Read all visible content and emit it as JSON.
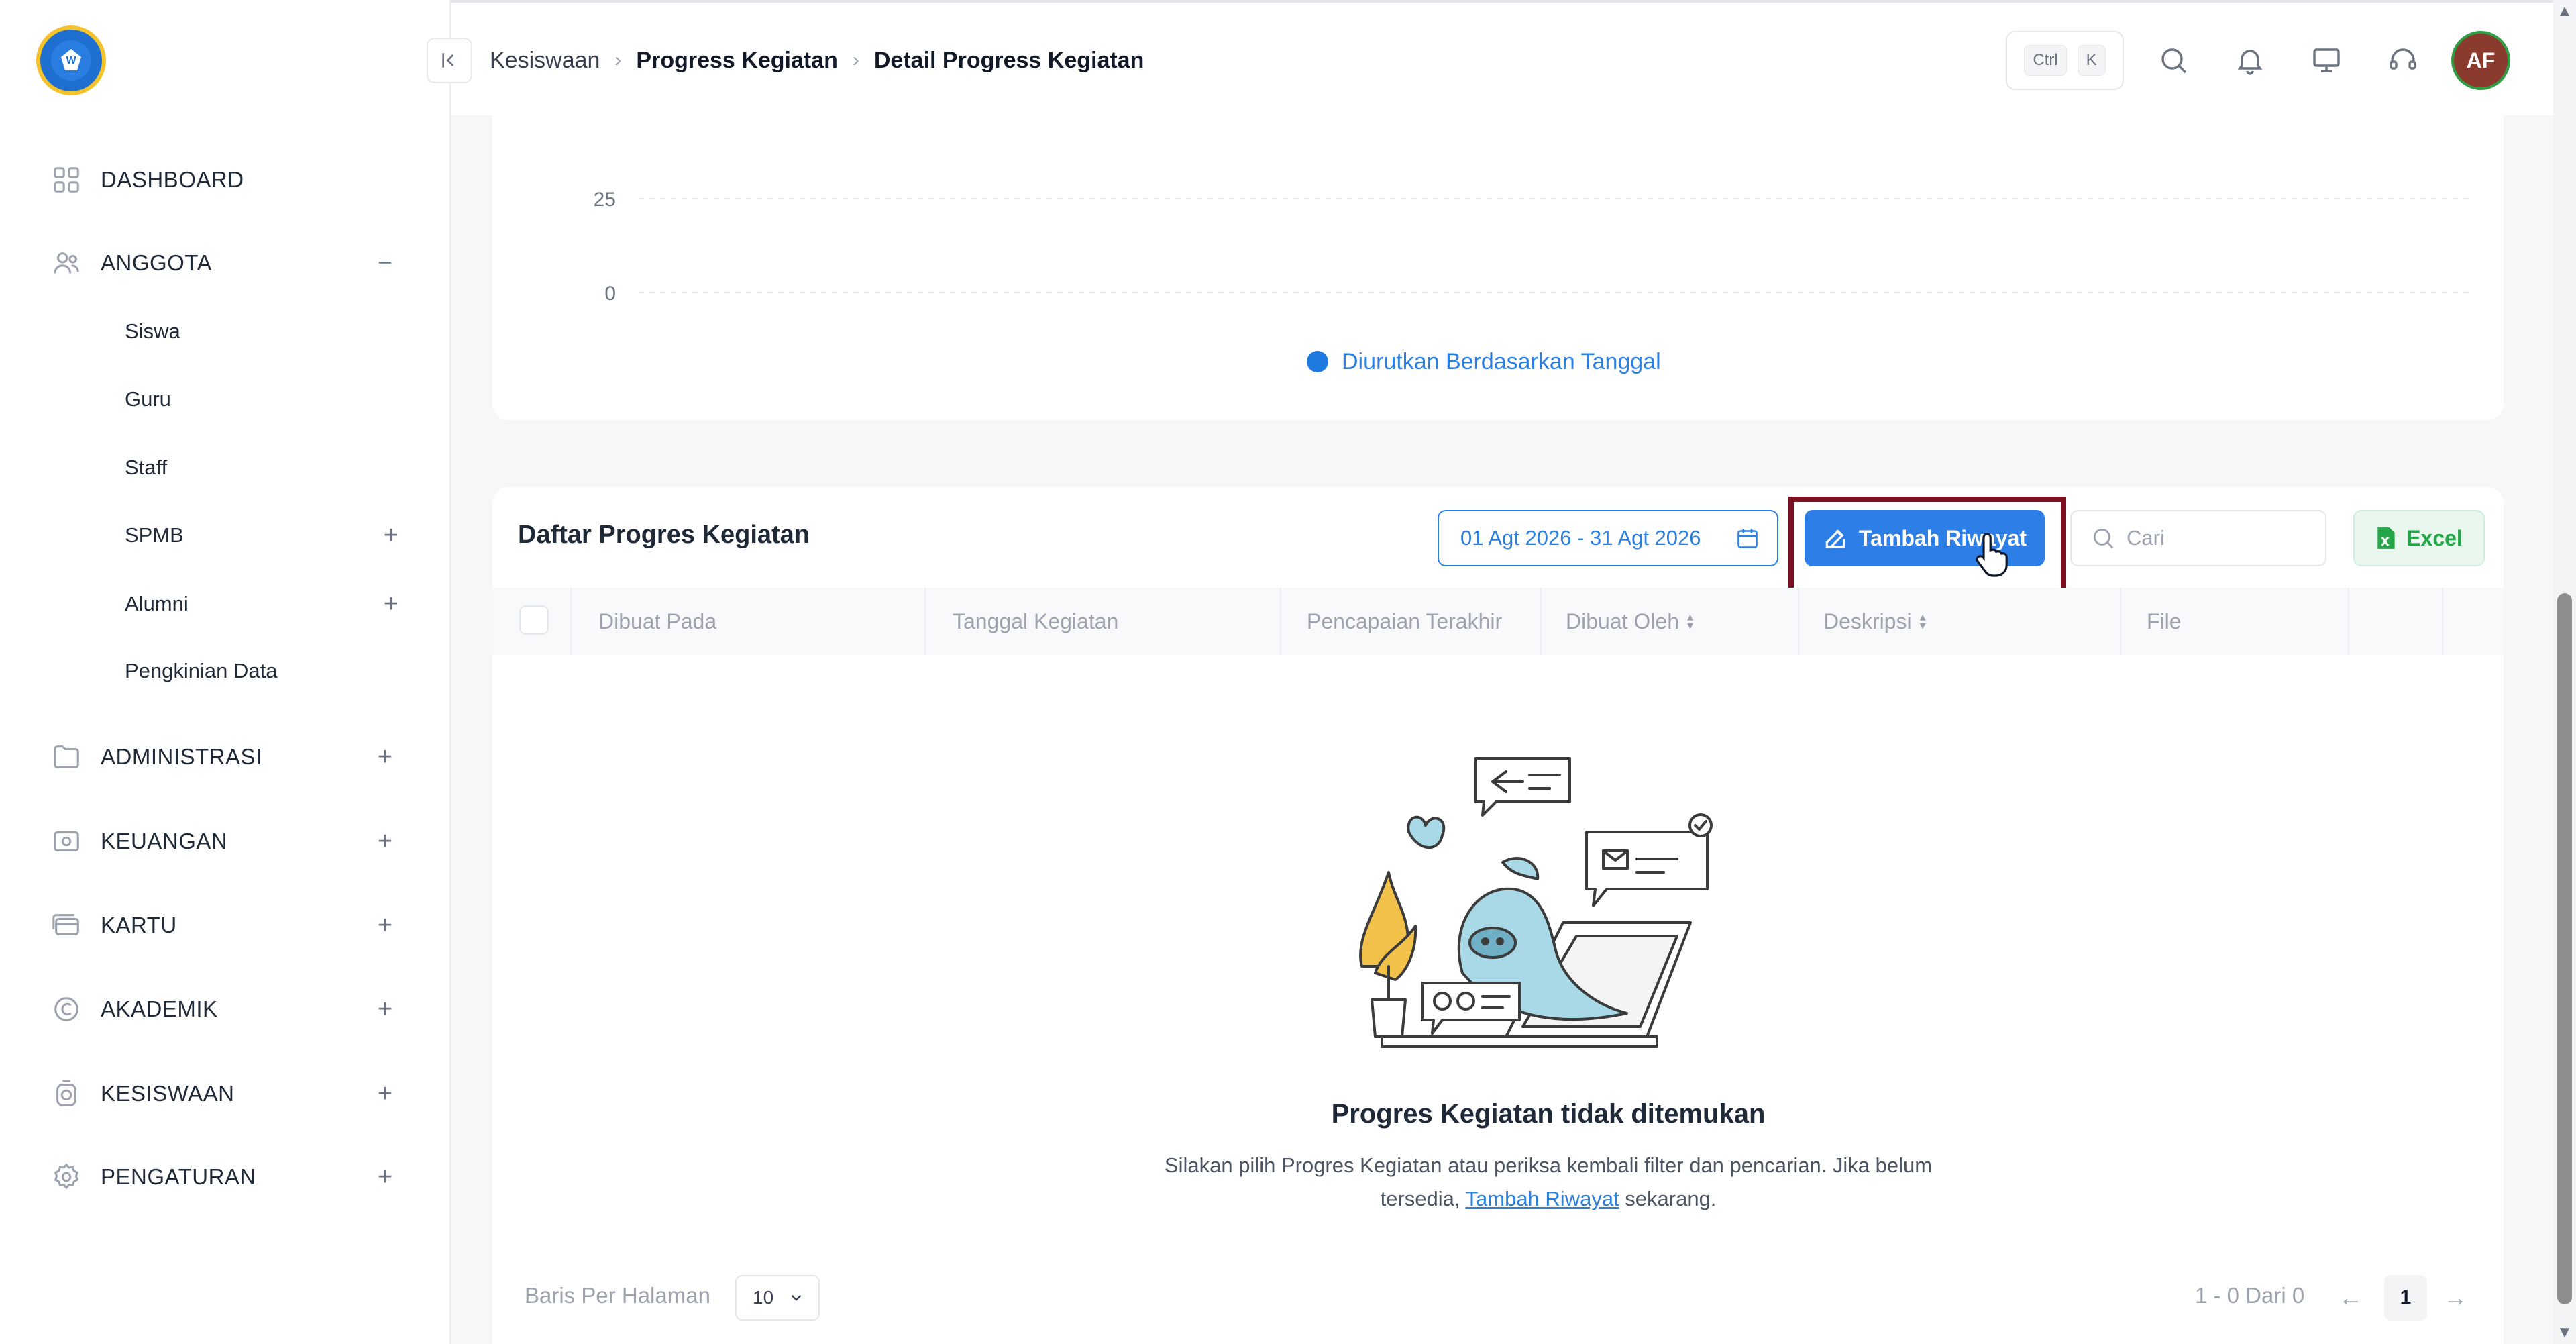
{
  "sidebar": {
    "items": [
      {
        "label": "DASHBOARD"
      },
      {
        "label": "ANGGOTA",
        "toggle": "−"
      },
      {
        "label": "ADMINISTRASI",
        "toggle": "+"
      },
      {
        "label": "KEUANGAN",
        "toggle": "+"
      },
      {
        "label": "KARTU",
        "toggle": "+"
      },
      {
        "label": "AKADEMIK",
        "toggle": "+"
      },
      {
        "label": "KESISWAAN",
        "toggle": "+"
      },
      {
        "label": "PENGATURAN",
        "toggle": "+"
      }
    ],
    "anggota_sub": [
      {
        "label": "Siswa"
      },
      {
        "label": "Guru"
      },
      {
        "label": "Staff"
      },
      {
        "label": "SPMB",
        "toggle": "+"
      },
      {
        "label": "Alumni",
        "toggle": "+"
      },
      {
        "label": "Pengkinian Data"
      }
    ]
  },
  "header": {
    "breadcrumb": [
      "Kesiswaan",
      "Progress Kegiatan",
      "Detail Progress Kegiatan"
    ],
    "breadcrumb_sep": "›",
    "shortcut_ctrl": "Ctrl",
    "shortcut_key": "K",
    "avatar_initials": "AF"
  },
  "chart_data": {
    "type": "line",
    "title": "",
    "xlabel": "",
    "ylabel": "",
    "y_ticks": [
      "25",
      "0"
    ],
    "series": [
      {
        "name": "Diurutkan Berdasarkan Tanggal",
        "values": []
      }
    ],
    "legend_position": "bottom-center",
    "grid": true,
    "color": "#1f7ae0"
  },
  "table_card": {
    "title": "Daftar Progres Kegiatan",
    "date_range": "01 Agt 2026 - 31 Agt 2026",
    "add_button": "Tambah Riwayat",
    "search_placeholder": "Cari",
    "excel_button": "Excel",
    "columns": [
      "Dibuat Pada",
      "Tanggal Kegiatan",
      "Pencapaian Terakhir",
      "Dibuat Oleh",
      "Deskripsi",
      "File"
    ],
    "rows": []
  },
  "empty_state": {
    "title": "Progres Kegiatan tidak ditemukan",
    "desc_before": "Silakan pilih Progres Kegiatan atau periksa kembali filter dan pencarian. Jika belum tersedia, ",
    "desc_link": "Tambah Riwayat",
    "desc_after": " sekarang."
  },
  "pagination": {
    "rows_per_page_label": "Baris Per Halaman",
    "rows_per_page_value": "10",
    "page_info": "1 - 0 Dari 0",
    "prev": "←",
    "current_page": "1",
    "next": "→"
  },
  "colors": {
    "primary": "#2d7ee6",
    "highlight": "#7b1020",
    "excel": "#22a447"
  }
}
